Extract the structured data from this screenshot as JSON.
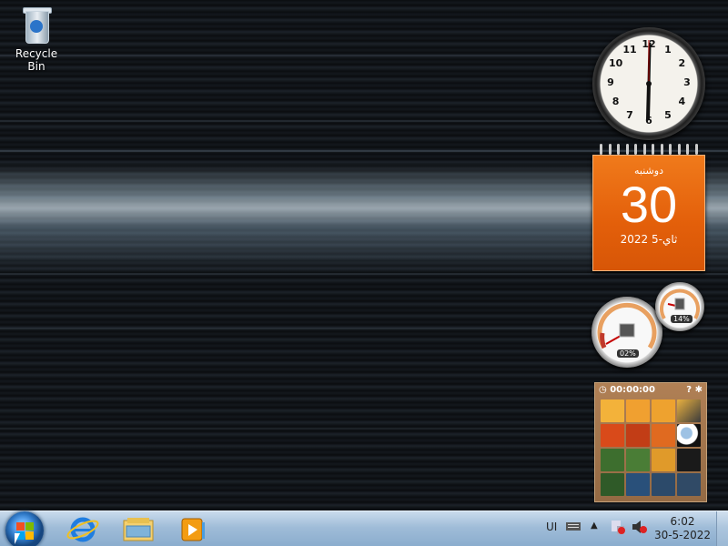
{
  "desktop": {
    "icons": [
      {
        "label": "Recycle Bin",
        "icon": "recycle-bin-icon"
      }
    ]
  },
  "gadgets": {
    "clock": {
      "hour_numerals": [
        "12",
        "1",
        "2",
        "3",
        "4",
        "5",
        "6",
        "7",
        "8",
        "9",
        "10",
        "11"
      ],
      "time_shown": "6:02"
    },
    "calendar": {
      "weekday": "دوشنبه",
      "day": "30",
      "month_year": "ثاي-5 2022"
    },
    "cpu_meter": {
      "cpu_label": "02%",
      "memory_label": "14%",
      "cpu": 2,
      "memory": 14
    },
    "puzzle": {
      "timer": "00:00:00"
    }
  },
  "taskbar": {
    "start_icon": "windows-start-orb-icon",
    "pinned": [
      {
        "name": "internet-explorer",
        "icon": "internet-explorer-icon"
      },
      {
        "name": "windows-explorer",
        "icon": "folder-library-icon"
      },
      {
        "name": "media-player",
        "icon": "media-player-icon"
      }
    ],
    "tray": {
      "language": "UI",
      "clock_time": "6:02",
      "clock_date": "30-5-2022"
    }
  },
  "colors": {
    "calendar_accent": "#e8650e",
    "taskbar": "#9fbcd8"
  }
}
